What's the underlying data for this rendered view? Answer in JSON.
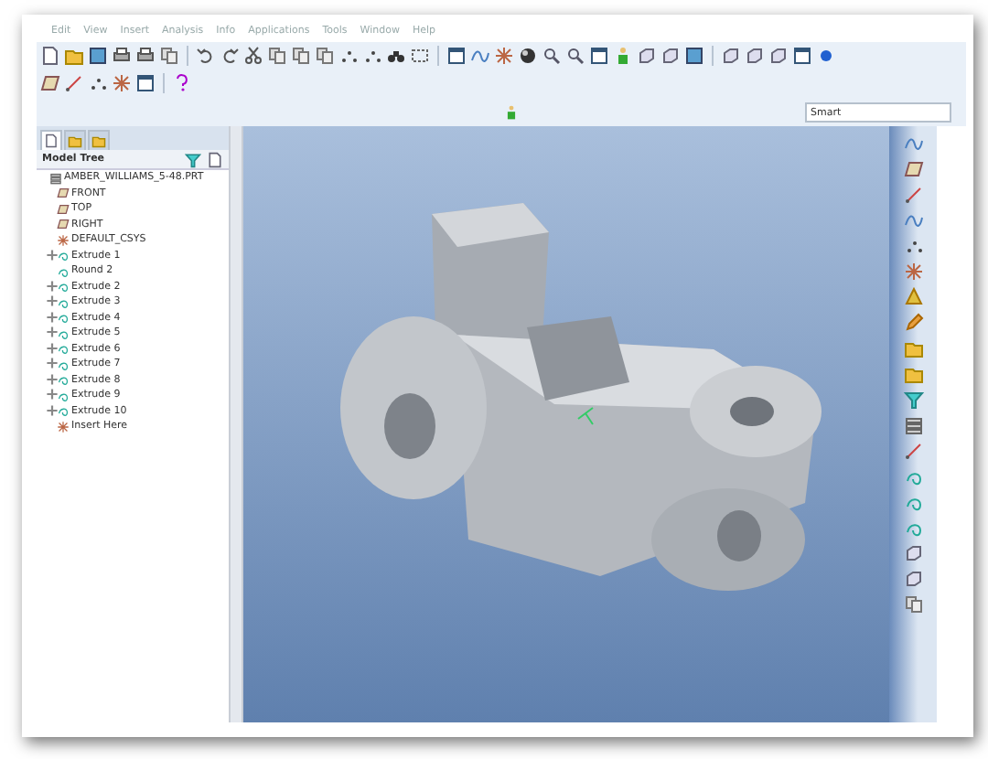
{
  "menu_bar": [
    "Edit",
    "View",
    "Insert",
    "Analysis",
    "Info",
    "Applications",
    "Tools",
    "Window",
    "Help"
  ],
  "filter": {
    "value": "Smart"
  },
  "navigator_tabs": [
    {
      "selected": true
    },
    {
      "selected": false
    },
    {
      "selected": false
    }
  ],
  "model_tree": {
    "title": "Model Tree",
    "root": {
      "label": "AMBER_WILLIAMS_5-48.PRT",
      "kind": "part",
      "children": [
        {
          "label": "FRONT",
          "kind": "datum-plane"
        },
        {
          "label": "TOP",
          "kind": "datum-plane"
        },
        {
          "label": "RIGHT",
          "kind": "datum-plane"
        },
        {
          "label": "DEFAULT_CSYS",
          "kind": "csys"
        },
        {
          "label": "Extrude 1",
          "kind": "feature",
          "expanded": false
        },
        {
          "label": "Round 2",
          "kind": "round"
        },
        {
          "label": "Extrude 2",
          "kind": "feature",
          "expanded": false
        },
        {
          "label": "Extrude 3",
          "kind": "feature",
          "expanded": false
        },
        {
          "label": "Extrude 4",
          "kind": "feature",
          "expanded": false
        },
        {
          "label": "Extrude 5",
          "kind": "feature",
          "expanded": false
        },
        {
          "label": "Extrude 6",
          "kind": "feature",
          "expanded": false
        },
        {
          "label": "Extrude 7",
          "kind": "feature",
          "expanded": false
        },
        {
          "label": "Extrude 8",
          "kind": "feature",
          "expanded": false
        },
        {
          "label": "Extrude 9",
          "kind": "feature",
          "expanded": false
        },
        {
          "label": "Extrude 10",
          "kind": "feature",
          "expanded": false
        },
        {
          "label": "Insert Here",
          "kind": "insert"
        }
      ]
    }
  }
}
